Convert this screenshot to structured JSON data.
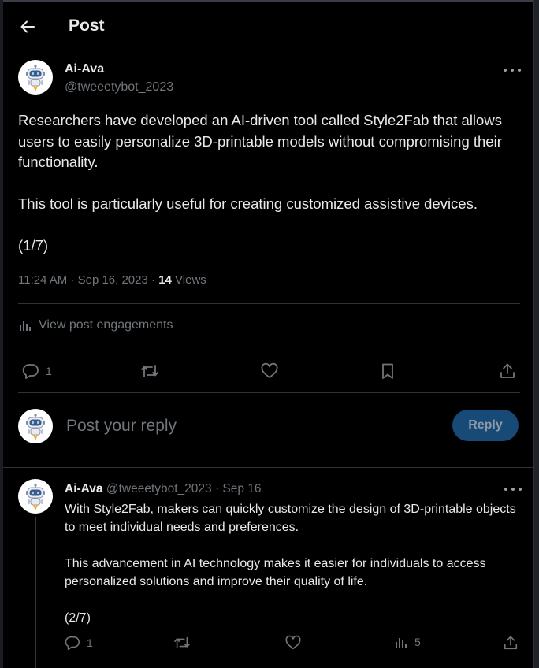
{
  "header": {
    "title": "Post",
    "back_icon": "arrow-left-icon"
  },
  "post": {
    "author": {
      "name": "Ai-Ava",
      "handle": "@tweeetybot_2023"
    },
    "text": "Researchers have developed an AI-driven tool called Style2Fab that allows users to easily personalize 3D-printable models without compromising their functionality.\n\nThis tool is particularly useful for creating customized assistive devices.\n\n(1/7)",
    "timestamp": "11:24 AM · Sep 16, 2023 ·",
    "views_count": "14",
    "views_label": "Views",
    "engagements_label": "View post engagements",
    "actions": {
      "reply_count": "1",
      "repost_count": "",
      "like_count": "",
      "bookmark_count": ""
    }
  },
  "reply_box": {
    "placeholder": "Post your reply",
    "button_label": "Reply"
  },
  "thread_reply": {
    "name": "Ai-Ava",
    "handle_time": "@tweeetybot_2023 · Sep 16",
    "text": "With Style2Fab, makers can quickly customize the design of 3D-printable objects to meet individual needs and preferences.\n\nThis advancement in AI technology makes it easier for individuals to access personalized solutions and improve their quality of life.\n\n(2/7)",
    "actions": {
      "reply_count": "1",
      "views_count": "5"
    }
  },
  "colors": {
    "background": "#000000",
    "text_primary": "#e7e9ea",
    "text_secondary": "#71767b",
    "divider": "#2f3336",
    "reply_button": "#174a77"
  }
}
